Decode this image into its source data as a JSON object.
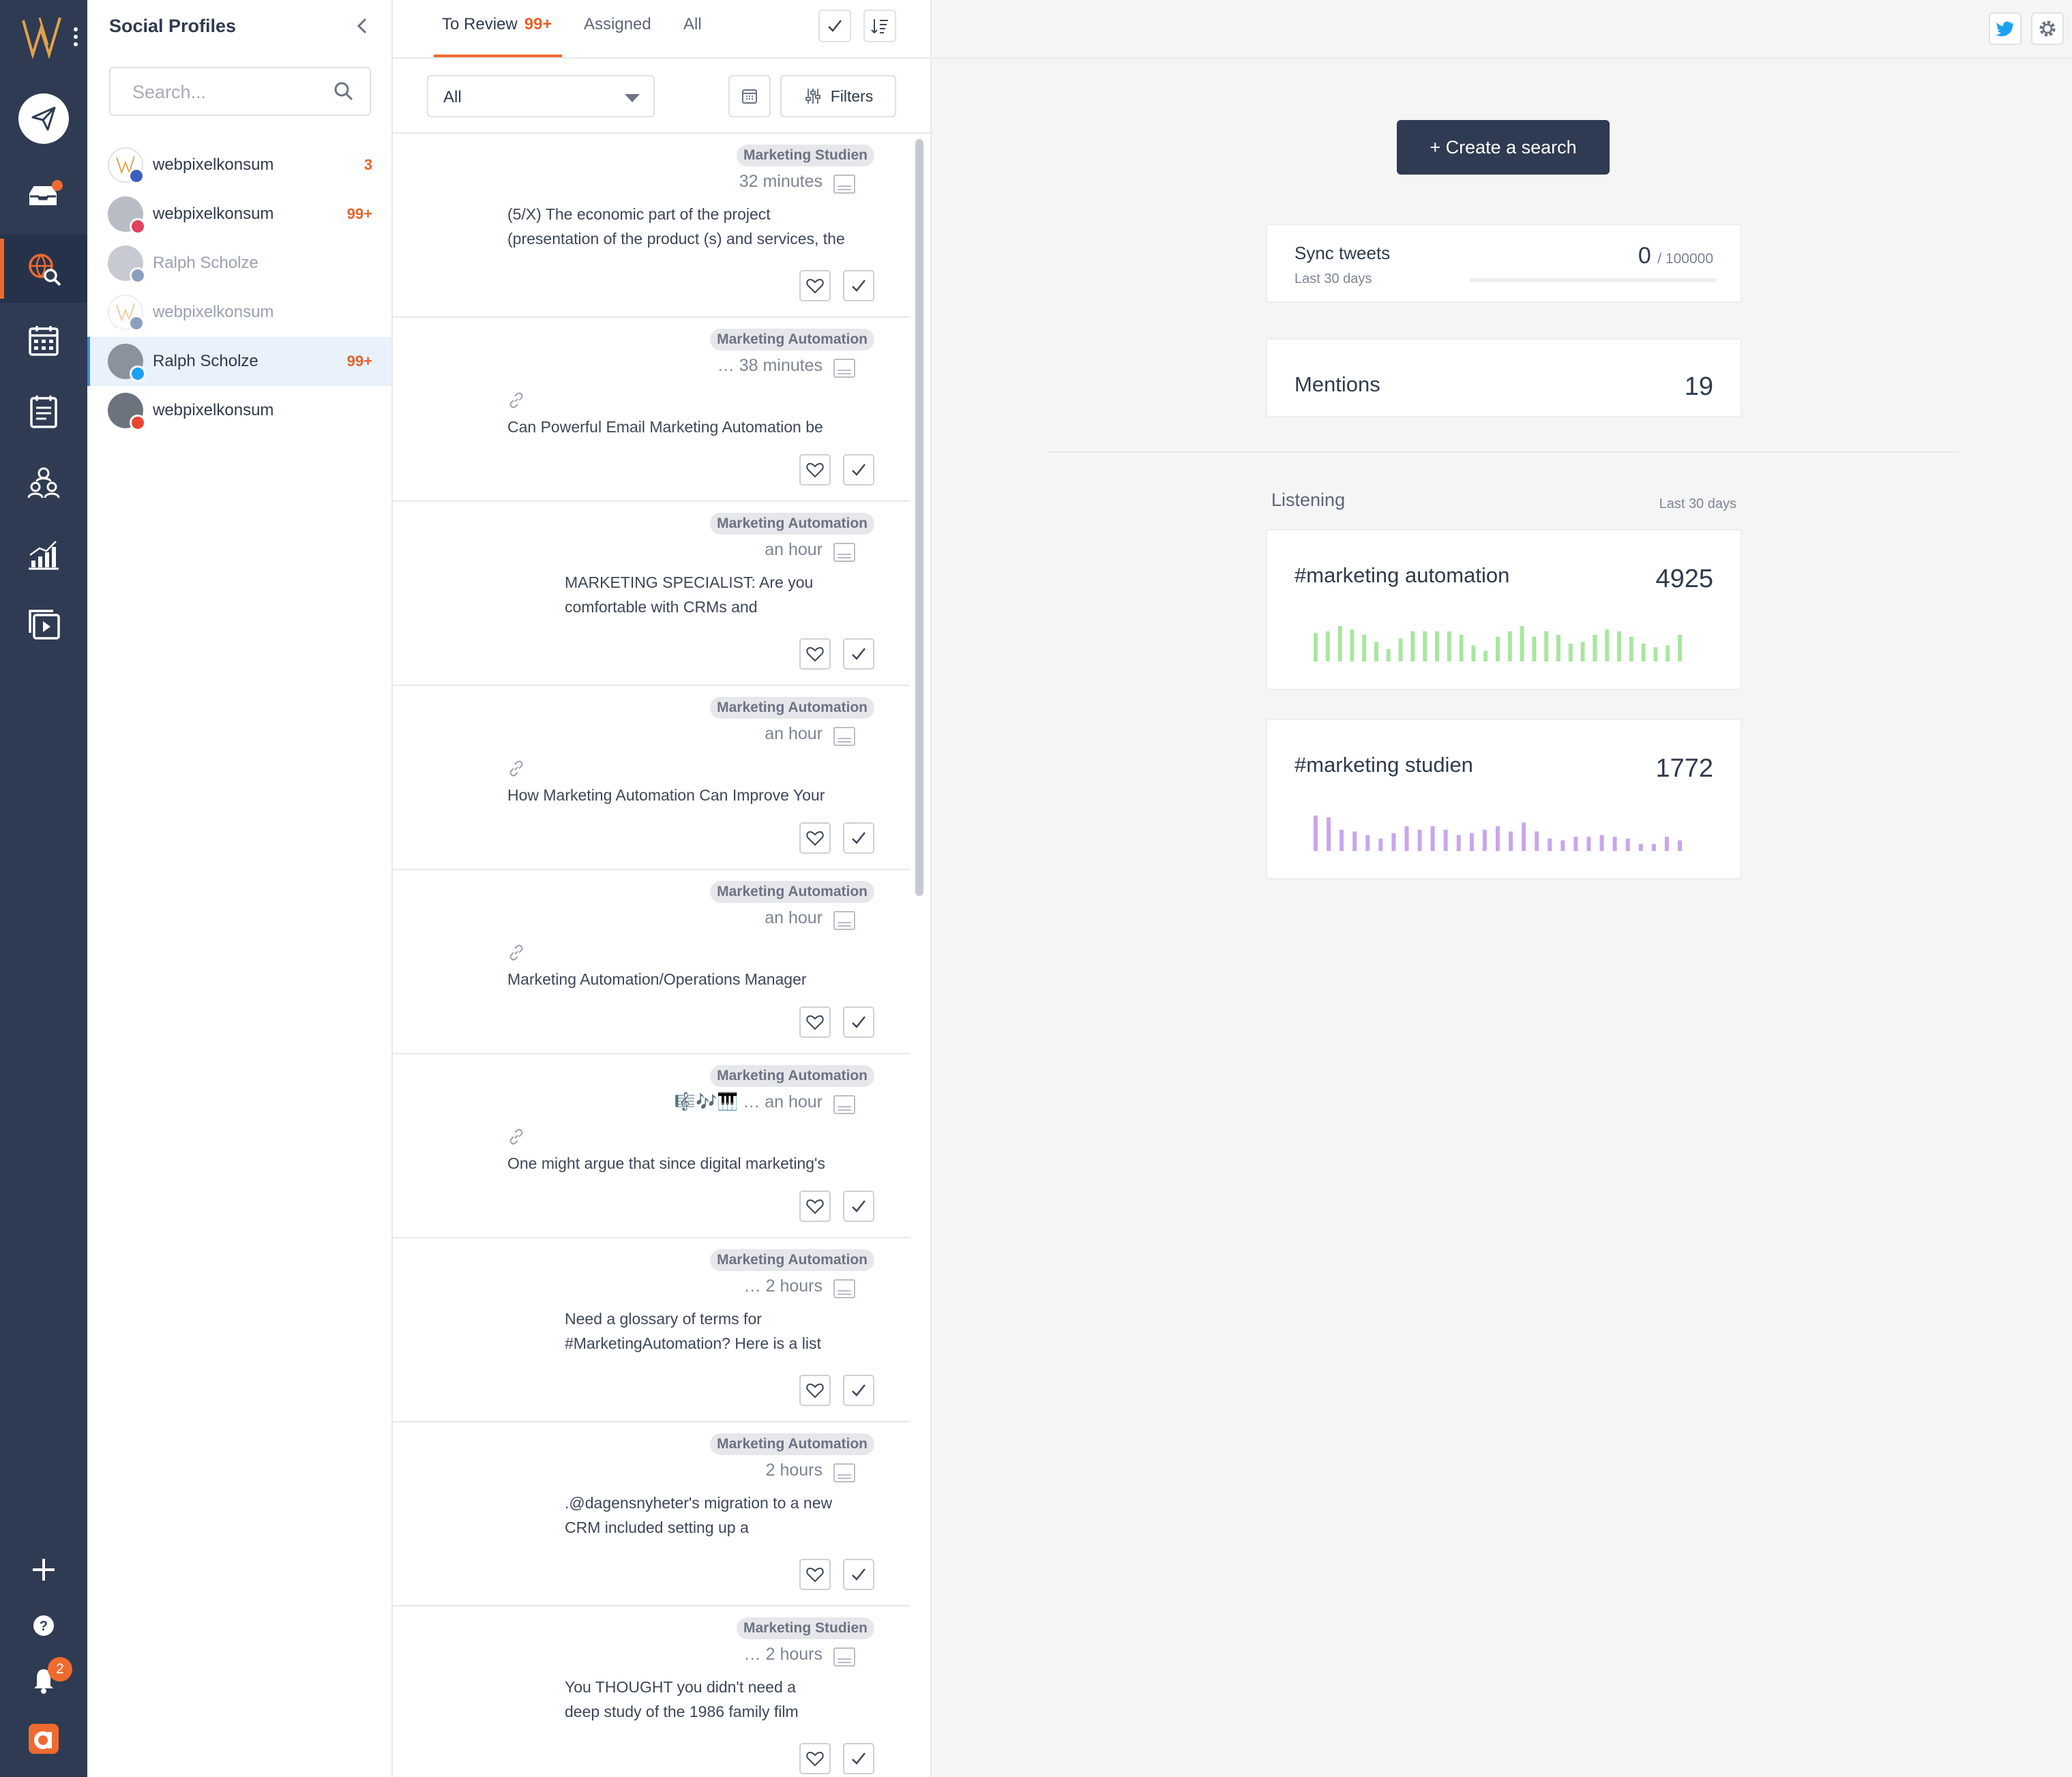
{
  "rail": {
    "notifications_count": "2",
    "items": [
      "compose",
      "inbox",
      "listening",
      "calendar",
      "tasks",
      "team",
      "analytics",
      "media"
    ]
  },
  "profiles": {
    "title": "Social Profiles",
    "search_placeholder": "Search...",
    "items": [
      {
        "name": "webpixelkonsum",
        "network": "facebook",
        "count": "3"
      },
      {
        "name": "webpixelkonsum",
        "network": "instagram",
        "count": "99+"
      },
      {
        "name": "Ralph Scholze",
        "network": "linkedin",
        "count": ""
      },
      {
        "name": "webpixelkonsum",
        "network": "linkedin",
        "count": ""
      },
      {
        "name": "Ralph Scholze",
        "network": "twitter",
        "count": "99+"
      },
      {
        "name": "webpixelkonsum",
        "network": "youtube",
        "count": ""
      }
    ]
  },
  "review": {
    "tabs": [
      {
        "label": "To Review",
        "badge": "99+"
      },
      {
        "label": "Assigned"
      },
      {
        "label": "All"
      }
    ],
    "select_value": "All",
    "filters_label": "Filters",
    "cards": [
      {
        "tag": "Marketing Studien",
        "time": "32 minutes",
        "text": [
          "(5/X) The economic part of the project",
          "(presentation of the product (s) and services, the"
        ]
      },
      {
        "tag": "Marketing Automation",
        "time": "… 38 minutes",
        "text": [
          "Can Powerful Email Marketing Automation be"
        ]
      },
      {
        "tag": "Marketing Automation",
        "time": "an hour",
        "text": [
          "MARKETING SPECIALIST: Are you",
          "comfortable with CRMs and"
        ]
      },
      {
        "tag": "Marketing Automation",
        "time": "an hour",
        "text": [
          "How Marketing Automation Can Improve Your"
        ]
      },
      {
        "tag": "Marketing Automation",
        "time": "an hour",
        "text": [
          "Marketing Automation/Operations Manager"
        ]
      },
      {
        "tag": "Marketing Automation",
        "time": "🎼🎶🎹 … an hour",
        "text": [
          "One might argue that since digital marketing's"
        ]
      },
      {
        "tag": "Marketing Automation",
        "time": "… 2 hours",
        "text": [
          "Need a glossary of terms for",
          "#MarketingAutomation? Here is a list"
        ]
      },
      {
        "tag": "Marketing Automation",
        "time": "2 hours",
        "text": [
          ".@dagensnyheter's migration to a new",
          "CRM included setting up a"
        ]
      },
      {
        "tag": "Marketing Studien",
        "time": "… 2 hours",
        "text": [
          "You THOUGHT you didn't need a",
          "deep study of the 1986 family film"
        ]
      }
    ]
  },
  "right": {
    "create_label": "+ Create a search",
    "sync": {
      "label": "Sync tweets",
      "sub": "Last 30 days",
      "value": "0",
      "limit": "/ 100000",
      "progress": 0
    },
    "mentions": {
      "label": "Mentions",
      "value": "19"
    },
    "listening": {
      "title": "Listening",
      "range": "Last 30 days"
    },
    "hashtags": [
      {
        "label": "#marketing automation",
        "value": "4925",
        "color": "#a8e6a0",
        "bars": [
          0.8,
          0.85,
          1.0,
          0.9,
          0.75,
          0.55,
          0.35,
          0.65,
          0.85,
          0.85,
          0.85,
          0.85,
          0.75,
          0.45,
          0.3,
          0.7,
          0.85,
          1.0,
          0.7,
          0.85,
          0.75,
          0.5,
          0.55,
          0.75,
          0.9,
          0.85,
          0.7,
          0.5,
          0.4,
          0.45,
          0.75
        ]
      },
      {
        "label": "#marketing studien",
        "value": "1772",
        "color": "#c9a6ec",
        "bars": [
          1.0,
          0.95,
          0.6,
          0.55,
          0.45,
          0.35,
          0.5,
          0.7,
          0.6,
          0.7,
          0.6,
          0.45,
          0.5,
          0.6,
          0.7,
          0.55,
          0.8,
          0.55,
          0.35,
          0.3,
          0.4,
          0.4,
          0.45,
          0.4,
          0.35,
          0.2,
          0.2,
          0.4,
          0.3
        ]
      }
    ]
  }
}
